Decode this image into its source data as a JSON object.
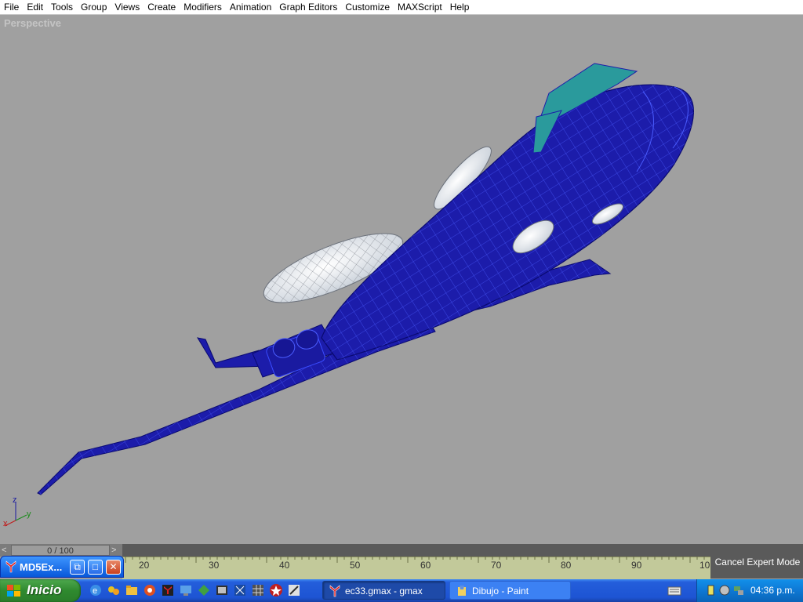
{
  "menu": [
    "File",
    "Edit",
    "Tools",
    "Group",
    "Views",
    "Create",
    "Modifiers",
    "Animation",
    "Graph Editors",
    "Customize",
    "MAXScript",
    "Help"
  ],
  "viewport": {
    "label": "Perspective"
  },
  "axis_labels": {
    "z": "z",
    "y": "y",
    "x": "x"
  },
  "timeline": {
    "slider_text": "0 / 100",
    "left_arrow": "<",
    "right_arrow": ">",
    "ticks": [
      "20",
      "30",
      "40",
      "50",
      "60",
      "70",
      "80",
      "90",
      "10"
    ]
  },
  "expert_mode": {
    "label": "Cancel Expert Mode"
  },
  "floating_window": {
    "title": "MD5Ex..."
  },
  "taskbar": {
    "start_label": "Inicio",
    "tasks": [
      "ec33.gmax - gmax",
      "Dibujo - Paint"
    ],
    "clock": "04:36 p.m."
  },
  "colors": {
    "viewport_bg": "#a0a0a0",
    "fuselage": "#1c1caa",
    "wireframe": "#3a4cff",
    "canopy": "#2a9a9c",
    "engine": "#d6dce4",
    "track": "#c2c99a",
    "taskbar": "#245edb",
    "start": "#3c9a3c"
  }
}
